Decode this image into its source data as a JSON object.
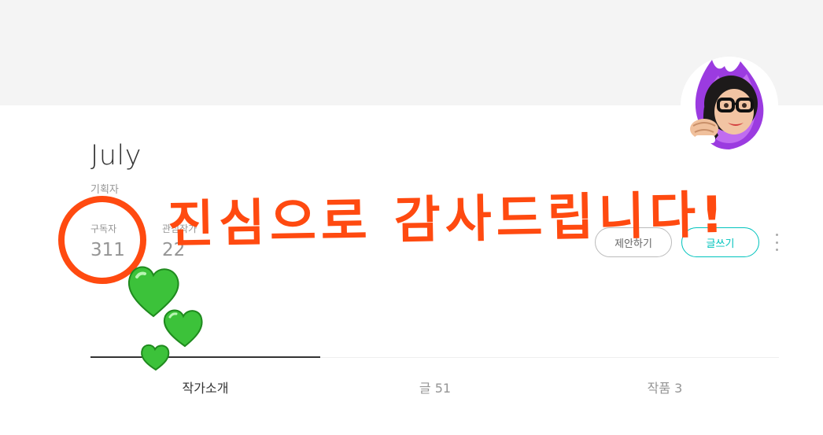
{
  "profile": {
    "name": "July",
    "job": "기획자",
    "stats": {
      "subscribers_label": "구독자",
      "subscribers_value": "311",
      "watching_label": "관심작가",
      "watching_value": "22"
    }
  },
  "actions": {
    "propose_label": "제안하기",
    "write_label": "글쓰기"
  },
  "tabs": [
    {
      "label": "작가소개",
      "active": true
    },
    {
      "label": "글 51",
      "active": false
    },
    {
      "label": "작품 3",
      "active": false
    }
  ],
  "annotation": {
    "text": "진심으로 감사드립니다!",
    "color": "#ff4a10",
    "heart_color": "#3cc23a"
  },
  "colors": {
    "accent": "#00c3bd",
    "cover": "#f4f4f4"
  }
}
